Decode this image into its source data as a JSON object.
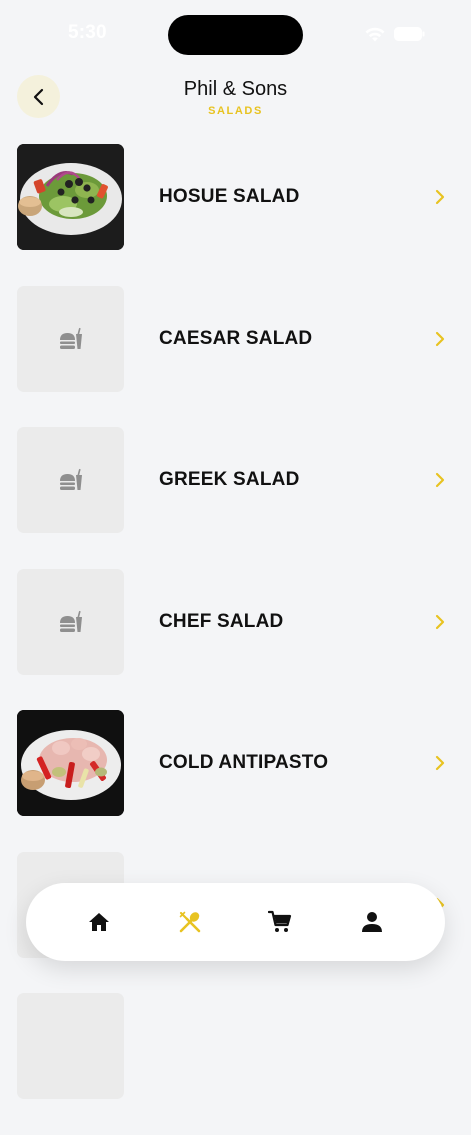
{
  "status_bar": {
    "time": "5:30",
    "icons": [
      "wifi-icon",
      "battery-icon"
    ]
  },
  "header": {
    "back_icon": "chevron-left-icon",
    "title": "Phil & Sons",
    "subtitle": "SALADS"
  },
  "colors": {
    "accent": "#e8c321",
    "background": "#f4f5f7",
    "back_button_bg": "#f4f1dc",
    "placeholder_bg": "#ebebeb",
    "placeholder_icon": "#8f8f8f"
  },
  "menu": {
    "items": [
      {
        "name": "HOSUE SALAD",
        "image": "salad-photo"
      },
      {
        "name": "CAESAR SALAD",
        "image": "food-placeholder-icon"
      },
      {
        "name": "GREEK SALAD",
        "image": "food-placeholder-icon"
      },
      {
        "name": "CHEF SALAD",
        "image": "food-placeholder-icon"
      },
      {
        "name": "COLD ANTIPASTO",
        "image": "antipasto-photo"
      },
      {
        "name": "",
        "image": "food-placeholder-icon"
      },
      {
        "name": "",
        "image": "food-placeholder-icon"
      }
    ]
  },
  "bottom_nav": {
    "items": [
      {
        "icon": "home-icon",
        "active": false
      },
      {
        "icon": "utensils-icon",
        "active": true
      },
      {
        "icon": "cart-icon",
        "active": false
      },
      {
        "icon": "profile-icon",
        "active": false
      }
    ]
  }
}
